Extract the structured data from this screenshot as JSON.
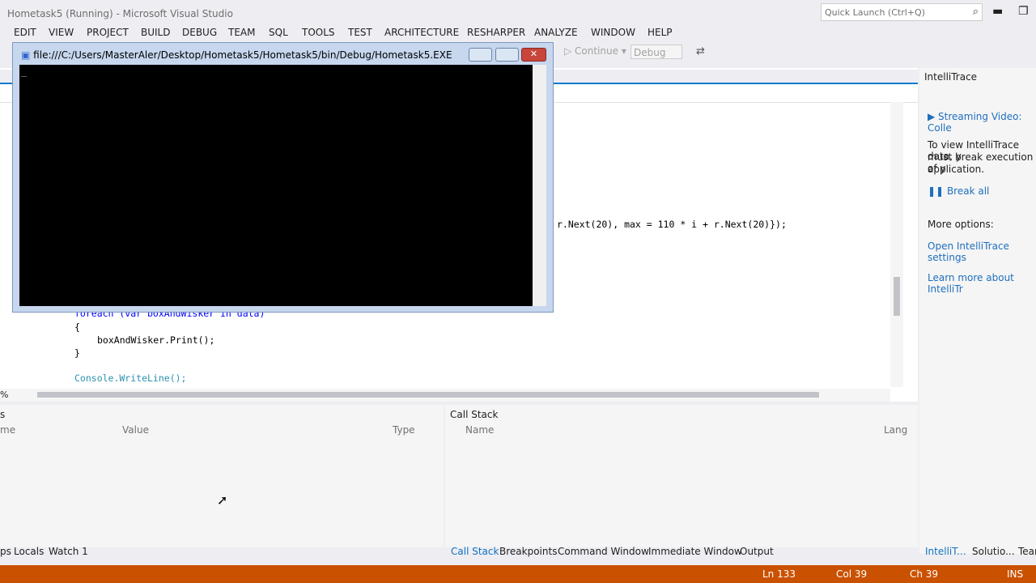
{
  "window": {
    "title": "Hometask5 (Running) - Microsoft Visual Studio"
  },
  "quick_launch": {
    "placeholder": "Quick Launch (Ctrl+Q)"
  },
  "menu": [
    "EDIT",
    "VIEW",
    "PROJECT",
    "BUILD",
    "DEBUG",
    "TEAM",
    "SQL",
    "TOOLS",
    "TEST",
    "ARCHITECTURE",
    "RESHARPER",
    "ANALYZE",
    "WINDOW",
    "HELP"
  ],
  "toolbar": {
    "continue_label": "Continue",
    "config_label": "Debug"
  },
  "console": {
    "title": "file:///C:/Users/MasterAler/Desktop/Hometask5/Hometask5/bin/Debug/Hometask5.EXE",
    "cursor": "_"
  },
  "editor": {
    "line_visible": "r.Next(20), max = 110 * i + r.Next(20)});",
    "foreach_line": "foreach (var boxAndWisker in data)",
    "brace_open": "{",
    "print_line": "boxAndWisker.Print();",
    "brace_close": "}",
    "console_line": "Console.WriteLine();"
  },
  "intellitrace": {
    "title": "IntelliTrace",
    "streaming": "Streaming Video: Colle",
    "desc1": "To view IntelliTrace data, y",
    "desc2": "must break execution of y",
    "desc3": "application.",
    "break_all": "Break all",
    "more_options": "More options:",
    "open_settings": "Open IntelliTrace settings",
    "learn_more": "Learn more about IntelliTr"
  },
  "locals_panel": {
    "header": "s",
    "columns": [
      "me",
      "Value",
      "Type"
    ],
    "tabs": [
      "ps",
      "Locals",
      "Watch 1"
    ]
  },
  "callstack_panel": {
    "header": "Call Stack",
    "columns": [
      "Name",
      "Lang"
    ],
    "tabs": [
      "Call Stack",
      "Breakpoints",
      "Command Window",
      "Immediate Window",
      "Output"
    ]
  },
  "right_tabs": [
    "IntelliT...",
    "Solutio...",
    "Tear"
  ],
  "zoom": "%",
  "status": {
    "ln": "Ln 133",
    "col": "Col 39",
    "ch": "Ch 39",
    "ins": "INS"
  },
  "colors": {
    "status_bar": "#ca5100",
    "accent": "#007acc"
  }
}
